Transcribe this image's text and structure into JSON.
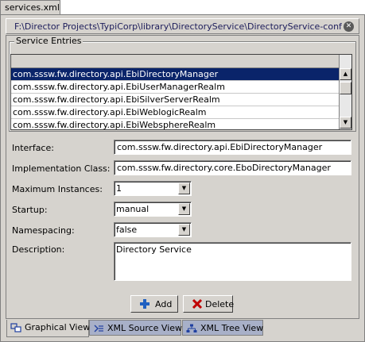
{
  "doc_tab": {
    "label": "services.xml"
  },
  "titlebar": {
    "path": "F:\\Director Projects\\TypiCorp\\library\\DirectoryService\\DirectoryService-conf\\service..."
  },
  "service_entries": {
    "legend": "Service Entries",
    "rows": [
      "com.sssw.fw.directory.api.EbiDirectoryManager",
      "com.sssw.fw.directory.api.EbiUserManagerRealm",
      "com.sssw.fw.directory.api.EbiSilverServerRealm",
      "com.sssw.fw.directory.api.EbiWeblogicRealm",
      "com.sssw.fw.directory.api.EbiWebsphereRealm"
    ],
    "selected_index": 0
  },
  "form": {
    "interface": {
      "label": "Interface:",
      "value": "com.sssw.fw.directory.api.EbiDirectoryManager"
    },
    "implementation_class": {
      "label": "Implementation Class:",
      "value": "com.sssw.fw.directory.core.EboDirectoryManager"
    },
    "maximum_instances": {
      "label": "Maximum Instances:",
      "value": "1"
    },
    "startup": {
      "label": "Startup:",
      "value": "manual"
    },
    "namespacing": {
      "label": "Namespacing:",
      "value": "false"
    },
    "description": {
      "label": "Description:",
      "value": "Directory Service"
    }
  },
  "buttons": {
    "add": "Add",
    "delete": "Delete"
  },
  "bottom_tabs": {
    "graphical": "Graphical View",
    "xml_source": "XML Source View",
    "xml_tree": "XML Tree View"
  },
  "colors": {
    "panel": "#d6d3ce",
    "selection": "#0a246a",
    "inactive_tab": "#a8b0c8",
    "add_icon": "#2060c0",
    "delete_icon": "#c00000"
  }
}
